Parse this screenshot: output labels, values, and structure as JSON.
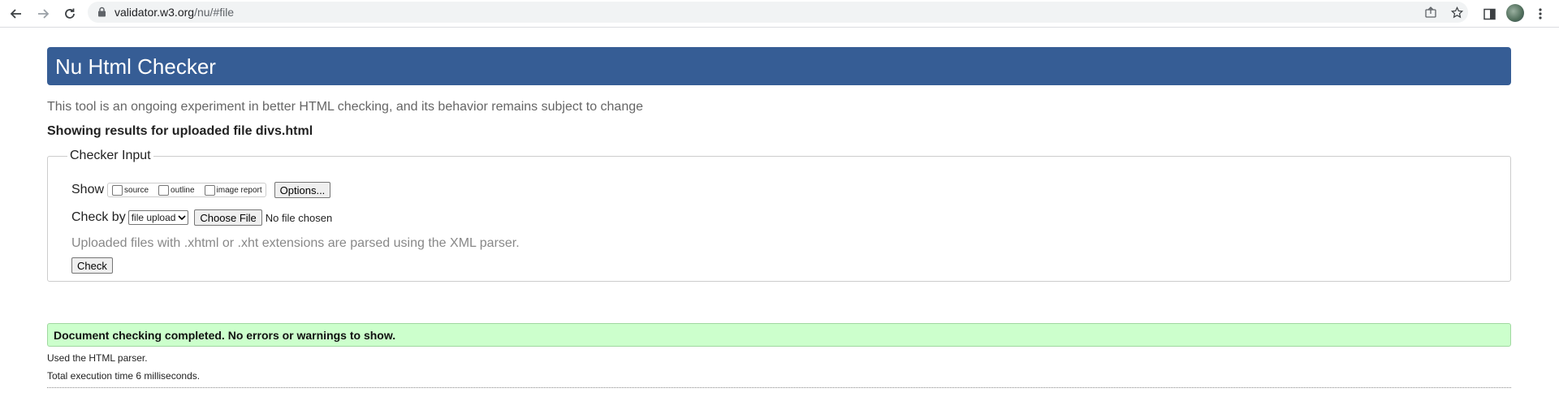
{
  "browser": {
    "url_host": "validator.w3.org",
    "url_path": "/nu/#file",
    "icons": [
      "back-icon",
      "forward-icon",
      "reload-icon",
      "lock-icon",
      "share-icon",
      "star-icon",
      "side-panel-icon",
      "avatar",
      "menu-icon"
    ]
  },
  "page": {
    "title": "Nu Html Checker",
    "intro": "This tool is an ongoing experiment in better HTML checking, and its behavior remains subject to change",
    "results_heading": "Showing results for uploaded file divs.html",
    "checker": {
      "legend": "Checker Input",
      "show_label": "Show",
      "show_options": [
        "source",
        "outline",
        "image report"
      ],
      "options_button": "Options...",
      "check_by_label": "Check by",
      "check_by_value": "file upload",
      "choose_file_button": "Choose File",
      "file_status": "No file chosen",
      "note": "Uploaded files with .xhtml or .xht extensions are parsed using the XML parser.",
      "check_button": "Check"
    },
    "status": "Document checking completed. No errors or warnings to show.",
    "parser_info": "Used the HTML parser.",
    "execution_time": "Total execution time 6 milliseconds."
  },
  "colors": {
    "header_bg": "#365d95",
    "success_bg": "#ccffcc"
  }
}
